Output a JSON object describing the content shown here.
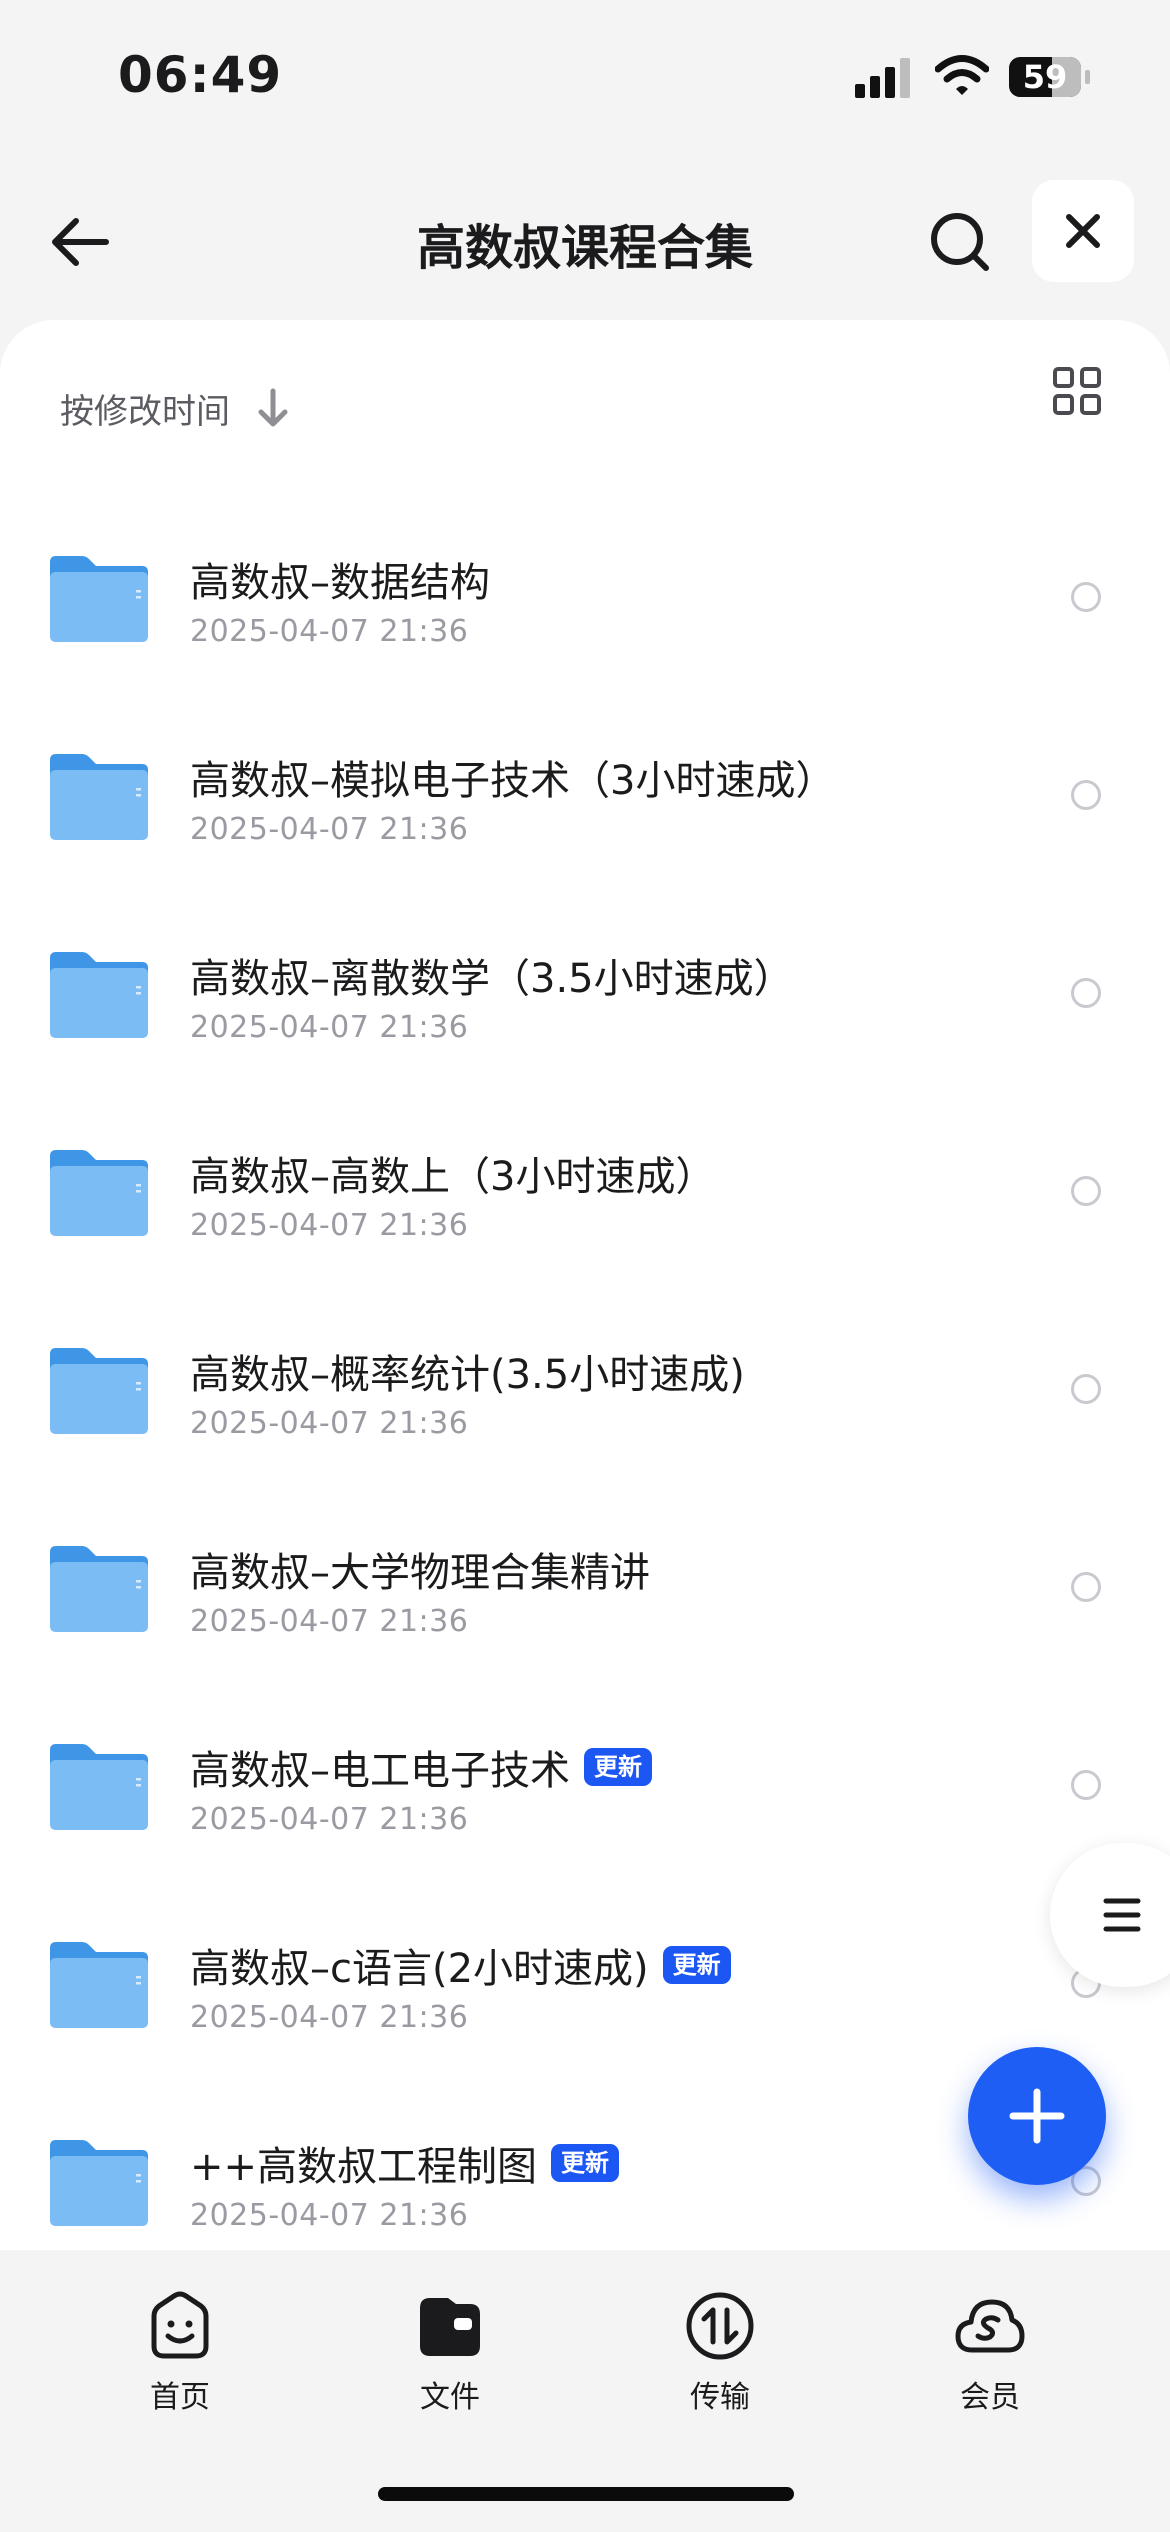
{
  "status_bar": {
    "time": "06:49",
    "battery": "59"
  },
  "nav": {
    "title": "高数叔课程合集",
    "back_icon": "arrow-left-icon",
    "search_icon": "search-icon",
    "close_icon": "close-icon"
  },
  "toolbar": {
    "sort_label": "按修改时间",
    "sort_icon": "arrow-down-icon",
    "view_icon": "grid-view-icon"
  },
  "files": [
    {
      "name": "高数叔–数据结构",
      "date": "2025-04-07 21:36",
      "badge": ""
    },
    {
      "name": "高数叔–模拟电子技术（3小时速成）",
      "date": "2025-04-07 21:36",
      "badge": ""
    },
    {
      "name": "高数叔–离散数学（3.5小时速成）",
      "date": "2025-04-07 21:36",
      "badge": ""
    },
    {
      "name": "高数叔–高数上（3小时速成）",
      "date": "2025-04-07 21:36",
      "badge": ""
    },
    {
      "name": "高数叔–概率统计(3.5小时速成)",
      "date": "2025-04-07 21:36",
      "badge": ""
    },
    {
      "name": "高数叔–大学物理合集精讲",
      "date": "2025-04-07 21:36",
      "badge": ""
    },
    {
      "name": "高数叔–电工电子技术",
      "date": "2025-04-07 21:36",
      "badge": "更新"
    },
    {
      "name": "高数叔–c语言(2小时速成)",
      "date": "2025-04-07 21:36",
      "badge": "更新"
    },
    {
      "name": "++高数叔工程制图",
      "date": "2025-04-07 21:36",
      "badge": "更新"
    }
  ],
  "colors": {
    "accent": "#1e5ef5",
    "folder": "#5aa9f0",
    "badge": "#1c56f3"
  },
  "tabs": [
    {
      "label": "首页",
      "icon": "smile-face-icon"
    },
    {
      "label": "文件",
      "icon": "folder-wallet-icon"
    },
    {
      "label": "传输",
      "icon": "transfer-icon"
    },
    {
      "label": "会员",
      "icon": "cloud-s-icon"
    }
  ]
}
